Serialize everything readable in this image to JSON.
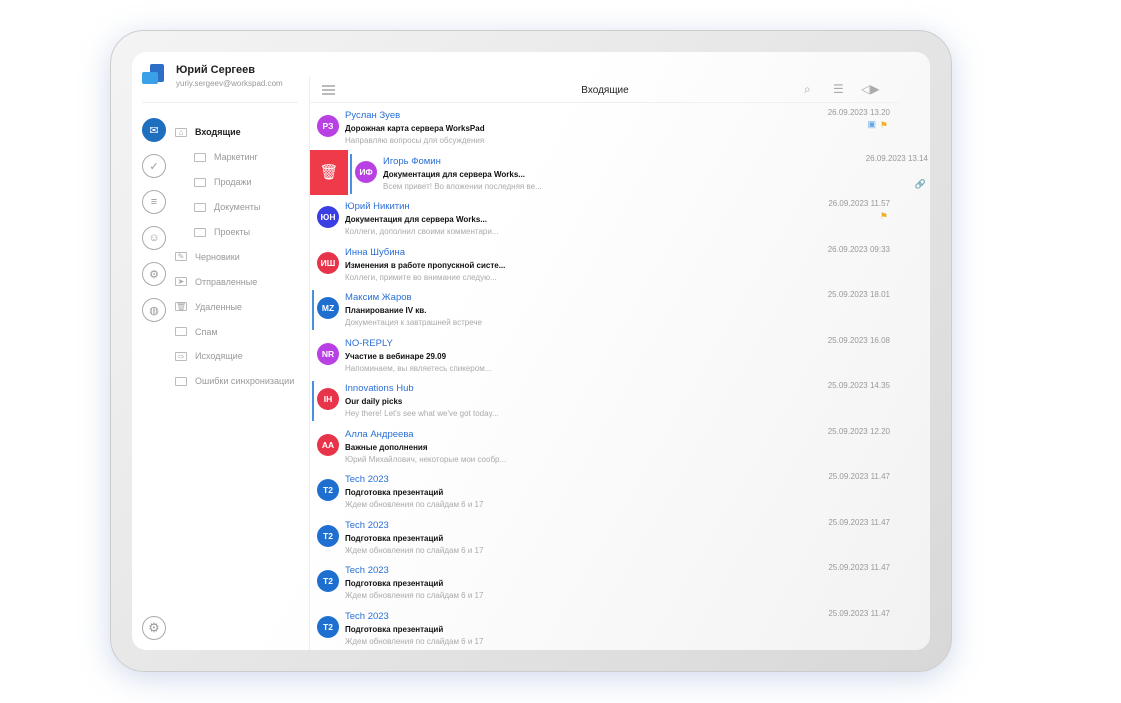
{
  "account": {
    "name": "Юрий Сергеев",
    "email": "yuriy.sergeev@workspad.com"
  },
  "rail": [
    {
      "icon": "mail-icon",
      "glyph": "✉"
    },
    {
      "icon": "calendar-icon",
      "glyph": "✓"
    },
    {
      "icon": "notes-icon",
      "glyph": "≡"
    },
    {
      "icon": "contacts-icon",
      "glyph": "☺"
    },
    {
      "icon": "ai-head-icon",
      "glyph": "⚙"
    },
    {
      "icon": "globe-icon",
      "glyph": "◍"
    }
  ],
  "folders": [
    {
      "label": "Входящие",
      "icon": "inbox-icon",
      "active": true,
      "sub": false
    },
    {
      "label": "Маркетинг",
      "icon": "folder-icon",
      "sub": true
    },
    {
      "label": "Продажи",
      "icon": "folder-icon",
      "sub": true
    },
    {
      "label": "Документы",
      "icon": "folder-icon",
      "sub": true
    },
    {
      "label": "Проекты",
      "icon": "folder-icon",
      "sub": true
    },
    {
      "label": "Черновики",
      "icon": "draft-icon",
      "sub": false
    },
    {
      "label": "Отправленные",
      "icon": "send-icon",
      "sub": false
    },
    {
      "label": "Удаленные",
      "icon": "trash-icon",
      "sub": false
    },
    {
      "label": "Спам",
      "icon": "folder-icon",
      "sub": false
    },
    {
      "label": "Исходящие",
      "icon": "outbox-icon",
      "sub": false
    },
    {
      "label": "Ошибки синхронизации",
      "icon": "folder-icon",
      "sub": false
    }
  ],
  "header": {
    "title": "Входящие"
  },
  "colors": {
    "accent": "#2a6fd6",
    "delete": "#ef3a4a",
    "flag": "#f0b020"
  },
  "messages": [
    {
      "initials": "РЗ",
      "color": "#b940e2",
      "from": "Руслан Зуев",
      "subject": "Дорожная карта сервера WorksPad",
      "preview": "Направляю вопросы для обсуждения",
      "date": "26.09.2023 13.20",
      "flag": true,
      "calendar": true
    },
    {
      "initials": "ИФ",
      "color": "#b940e2",
      "from": "Игорь Фомин",
      "subject": "Документация для сервера Works...",
      "preview": "Всем привет! Во вложении последняя ве...",
      "date": "26.09.2023 13.14",
      "attachment": true,
      "swiped": true,
      "unread": true
    },
    {
      "initials": "ЮН",
      "color": "#3a3fe4",
      "from": "Юрий Никитин",
      "subject": "Документация для сервера Works...",
      "preview": "Коллеги, дополнил своими комментари...",
      "date": "26.09.2023 11.57",
      "flag": true
    },
    {
      "initials": "ИШ",
      "color": "#e8344a",
      "from": "Инна Шубина",
      "subject": "Изменения в работе пропускной систе...",
      "preview": "Коллеги, примите во внимание следую...",
      "date": "26.09.2023 09:33"
    },
    {
      "initials": "MZ",
      "color": "#1f6fd0",
      "from": "Максим Жаров",
      "subject": "Планирование IV кв.",
      "preview": "Документация к завтрашней встрече",
      "date": "25.09.2023 18.01",
      "unread": true
    },
    {
      "initials": "NR",
      "color": "#b940e2",
      "from": "NO-REPLY",
      "subject": "Участие в вебинаре 29.09",
      "preview": "Напоминаем, вы являетесь спикером...",
      "date": "25.09.2023 16.08"
    },
    {
      "initials": "IH",
      "color": "#e8344a",
      "from": "Innovations Hub",
      "subject": "Our daily picks",
      "preview": "Hey there! Let's see what we've got today...",
      "date": "25.09.2023 14.35",
      "unread": true
    },
    {
      "initials": "AA",
      "color": "#e8344a",
      "from": "Алла Андреева",
      "subject": "Важные дополнения",
      "preview": "Юрий Михайлович, некоторые мои сообр...",
      "date": "25.09.2023 12.20"
    },
    {
      "initials": "T2",
      "color": "#1f6fd0",
      "from": "Tech 2023",
      "subject": "Подготовка презентаций",
      "preview": "Ждем обновления по слайдам 6 и 17",
      "date": "25.09.2023 11.47"
    },
    {
      "initials": "T2",
      "color": "#1f6fd0",
      "from": "Tech 2023",
      "subject": "Подготовка презентаций",
      "preview": "Ждем обновления по слайдам 6 и 17",
      "date": "25.09.2023 11.47"
    },
    {
      "initials": "T2",
      "color": "#1f6fd0",
      "from": "Tech 2023",
      "subject": "Подготовка презентаций",
      "preview": "Ждем обновления по слайдам 6 и 17",
      "date": "25.09.2023 11.47"
    },
    {
      "initials": "T2",
      "color": "#1f6fd0",
      "from": "Tech 2023",
      "subject": "Подготовка презентаций",
      "preview": "Ждем обновления по слайдам 6 и 17",
      "date": "25.09.2023 11.47"
    }
  ]
}
